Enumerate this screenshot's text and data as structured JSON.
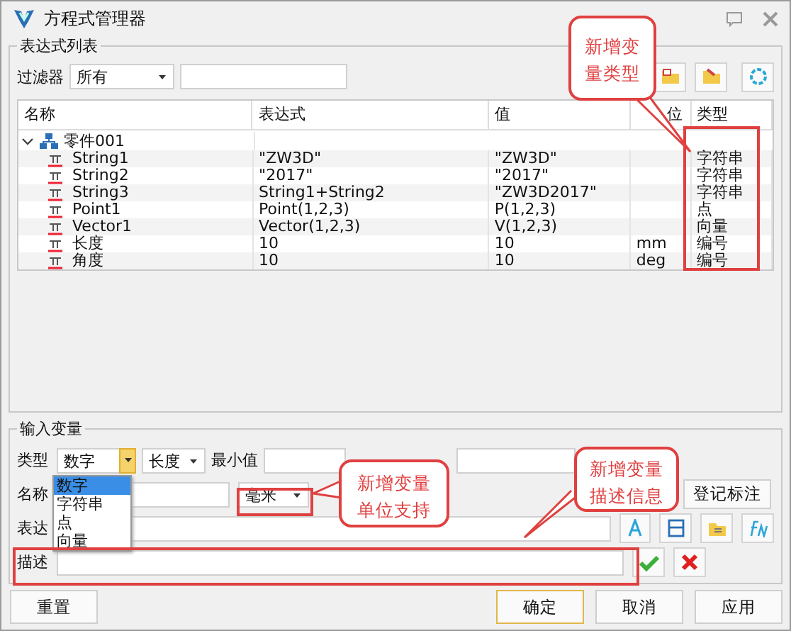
{
  "window": {
    "title": "方程式管理器"
  },
  "list_group": {
    "title": "表达式列表",
    "filter_label": "过滤器",
    "filter_value": "所有",
    "columns": [
      "名称",
      "表达式",
      "值",
      "位",
      "类型"
    ],
    "root": {
      "name": "零件001",
      "expanded": true,
      "children": [
        {
          "name": "String1",
          "expression": "\"ZW3D\"",
          "value": "\"ZW3D\"",
          "type": "字符串"
        },
        {
          "name": "String2",
          "expression": "\"2017\"",
          "value": "\"2017\"",
          "type": "字符串"
        },
        {
          "name": "String3",
          "expression": "String1+String2",
          "value": "\"ZW3D2017\"",
          "type": "字符串"
        },
        {
          "name": "Point1",
          "expression": "Point(1,2,3)",
          "value": "P(1,2,3)",
          "type": "点"
        },
        {
          "name": "Vector1",
          "expression": "Vector(1,2,3)",
          "value": "V(1,2,3)",
          "type": "向量"
        },
        {
          "name": "长度",
          "expression": "10",
          "value": "10",
          "unit": "mm",
          "type": "编号"
        },
        {
          "name": "角度",
          "expression": "10",
          "value": "10",
          "unit": "deg",
          "type": "编号"
        }
      ]
    }
  },
  "input_group": {
    "title": "输入变量",
    "type_label": "类型",
    "type_value": "数字",
    "category_value": "长度",
    "min_label": "最小值",
    "name_label": "名称",
    "unit_value": "毫米",
    "expr_label": "表达",
    "desc_label": "描述",
    "register_button": "登记标注",
    "type_options": [
      {
        "label": "数字",
        "selected": true
      },
      {
        "label": "字符串",
        "selected": false
      },
      {
        "label": "点",
        "selected": false
      },
      {
        "label": "向量",
        "selected": false
      }
    ]
  },
  "buttons": [
    {
      "label": "重置",
      "default": false
    },
    {
      "label": "确定",
      "default": true
    },
    {
      "label": "取消",
      "default": false
    },
    {
      "label": "应用",
      "default": false
    }
  ],
  "callouts": [
    "新增变量类型",
    "新增变量单位支持",
    "新增变量描述信息"
  ]
}
